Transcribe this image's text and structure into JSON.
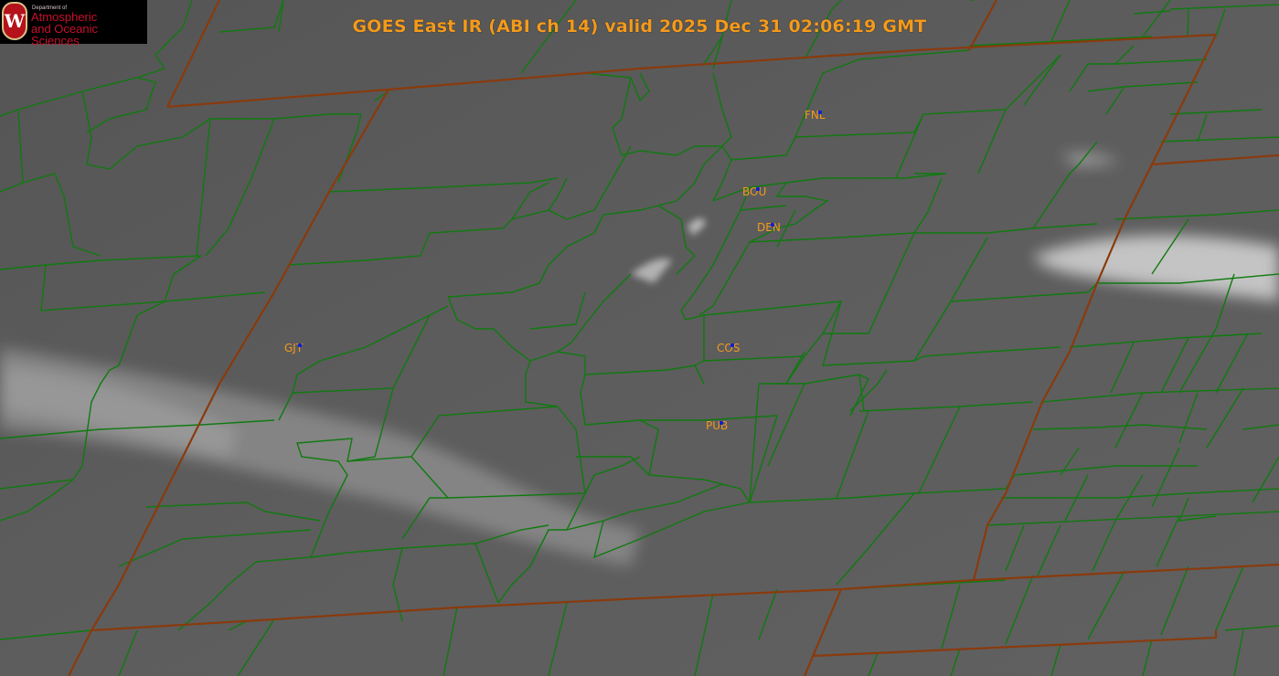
{
  "header": {
    "title": "GOES East IR (ABI ch 14) valid 2025 Dec 31 02:06:19 GMT"
  },
  "logo": {
    "crest_letter": "W",
    "department": "Department of",
    "name_line1": "Atmospheric",
    "name_line2": "and Oceanic Sciences"
  },
  "stations": [
    {
      "id": "FNL",
      "label": "FNL"
    },
    {
      "id": "BOU",
      "label": "BOU"
    },
    {
      "id": "DEN",
      "label": "DEN"
    },
    {
      "id": "GJT",
      "label": "GJT"
    },
    {
      "id": "COS",
      "label": "COS"
    },
    {
      "id": "PUB",
      "label": "PUB"
    }
  ],
  "colors": {
    "background": "#5e5e5e",
    "county_lines": "#0f7a0f",
    "state_lines": "#8a3a0c",
    "title_text": "#f39a1c",
    "station_marker": "#1020d0",
    "logo_red": "#c8102e"
  }
}
